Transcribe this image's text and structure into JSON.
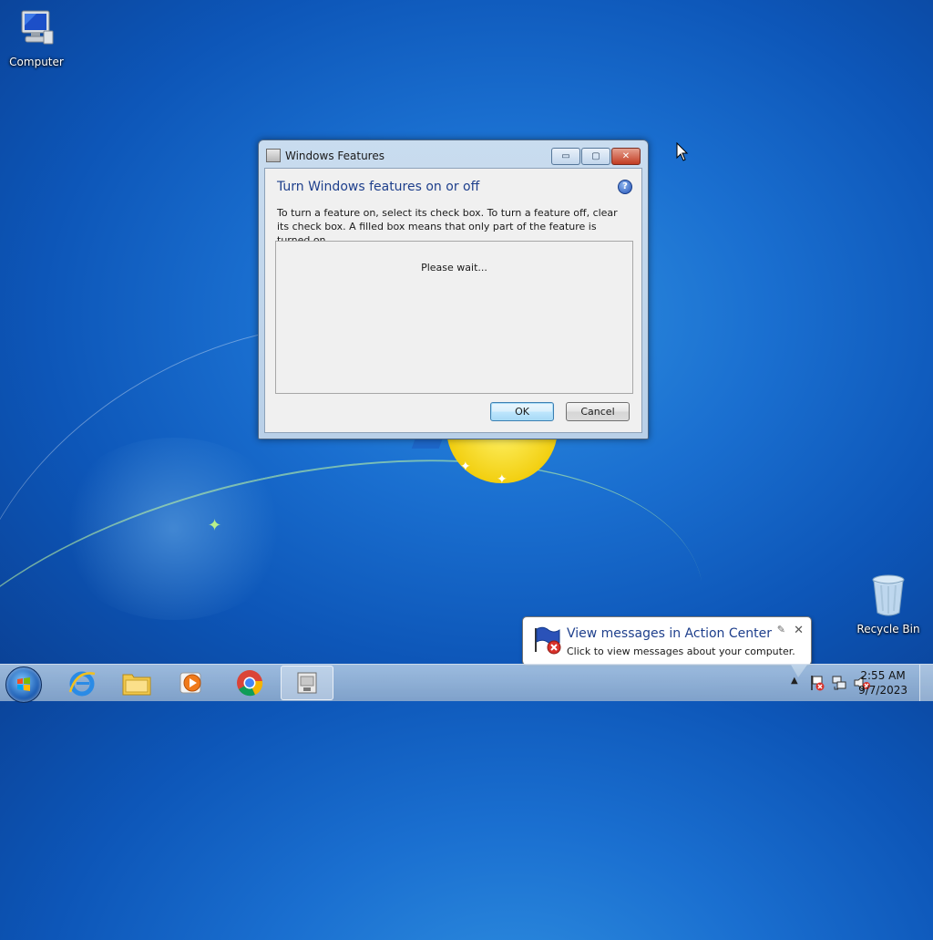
{
  "desktop": {
    "icons": [
      {
        "label": "Computer",
        "icon": "computer-icon"
      },
      {
        "label": "Recycle Bin",
        "icon": "recycle-bin-icon"
      }
    ]
  },
  "dialog": {
    "title": "Windows Features",
    "heading": "Turn Windows features on or off",
    "description": "To turn a feature on, select its check box. To turn a feature off, clear its check box. A filled box means that only part of the feature is turned on.",
    "status": "Please wait...",
    "ok_label": "OK",
    "cancel_label": "Cancel",
    "help_glyph": "?"
  },
  "notification": {
    "title": "View messages in Action Center",
    "text": "Click to view messages about your computer."
  },
  "taskbar": {
    "pinned": [
      "internet-explorer-icon",
      "file-explorer-icon",
      "media-player-icon",
      "chrome-icon",
      "windows-features-icon"
    ],
    "time": "2:55 AM",
    "date": "9/7/2023"
  },
  "colors": {
    "heading_blue": "#1e3f8c",
    "close_red": "#c23c22"
  }
}
